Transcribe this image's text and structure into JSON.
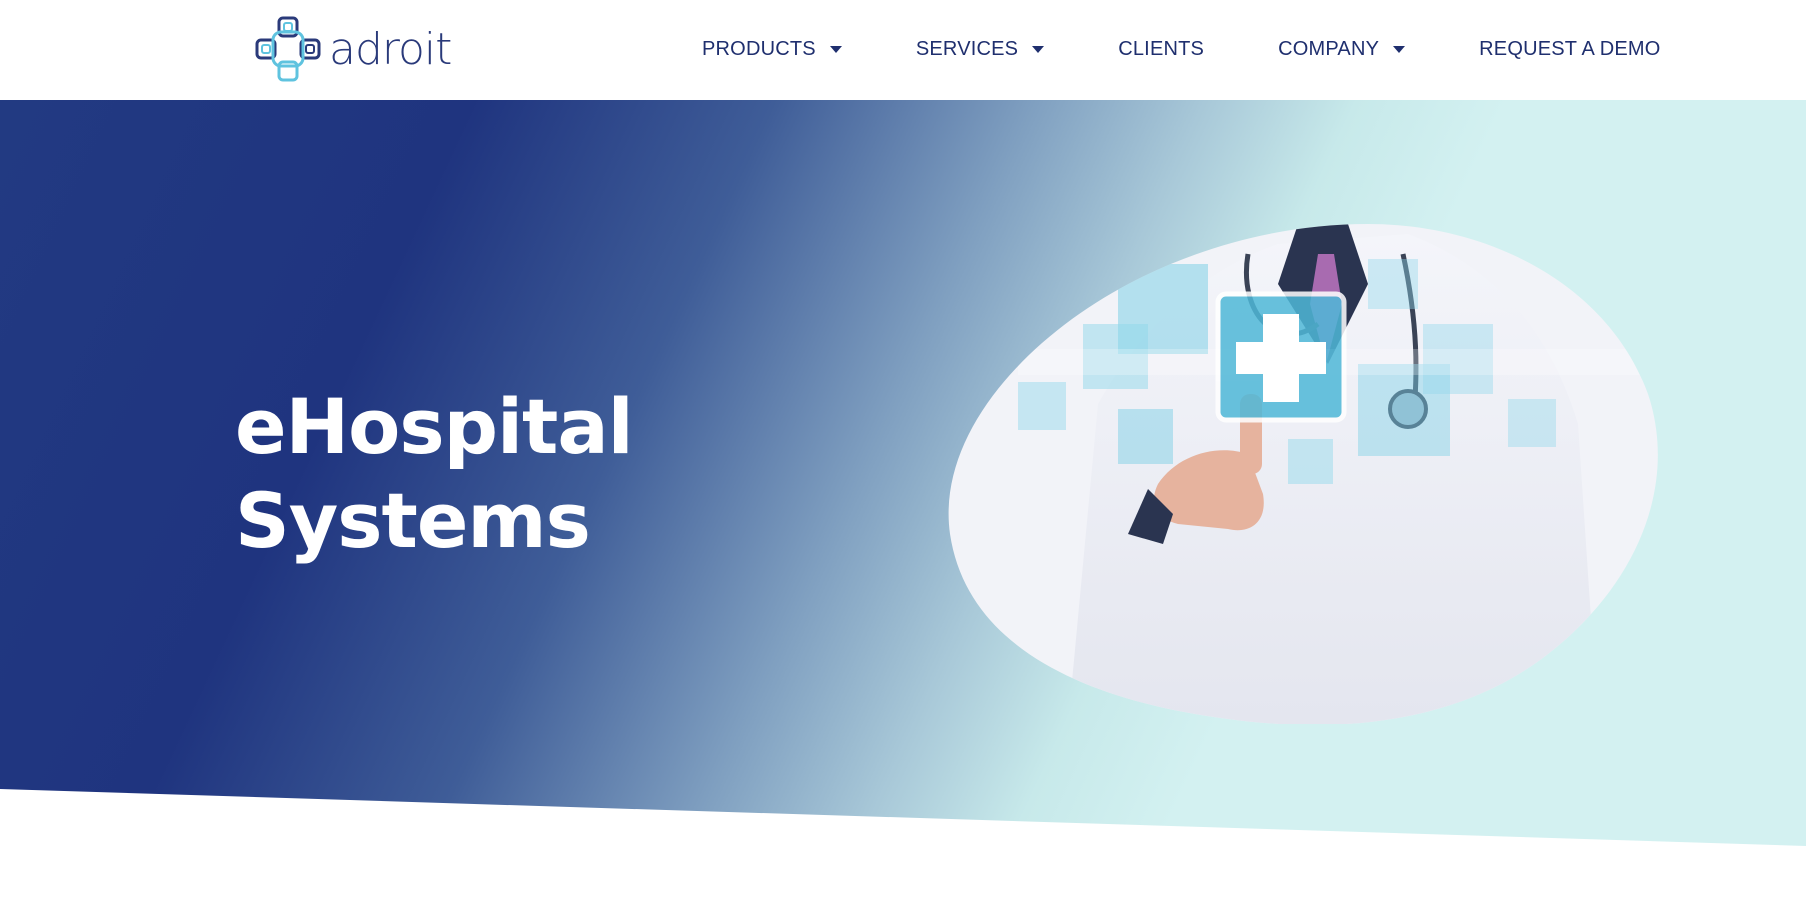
{
  "header": {
    "logo_text": "adroit",
    "nav": [
      {
        "label": "PRODUCTS",
        "has_dropdown": true
      },
      {
        "label": "SERVICES",
        "has_dropdown": true
      },
      {
        "label": "CLIENTS",
        "has_dropdown": false
      },
      {
        "label": "COMPANY",
        "has_dropdown": true
      },
      {
        "label": "REQUEST A DEMO",
        "has_dropdown": false
      }
    ]
  },
  "hero": {
    "title_line1": "eHospital",
    "title_line2": "Systems",
    "image_icon": "doctor-touching-medical-cross-icon"
  },
  "colors": {
    "brand_navy": "#1f2f6e",
    "hero_dark": "#1f347f",
    "hero_light": "#d3f1f1",
    "accent_cyan": "#5fc3df"
  }
}
